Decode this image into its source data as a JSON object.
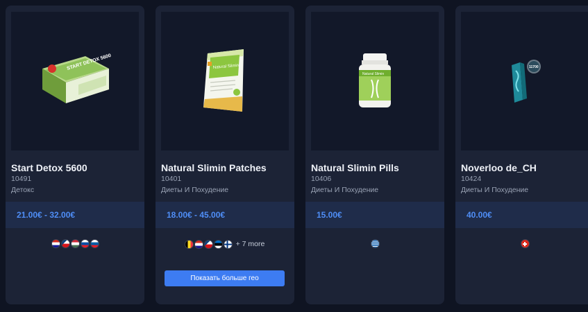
{
  "products": [
    {
      "title": "Start Detox 5600",
      "code": "10491",
      "category": "Детокс",
      "price": "21.00€ - 32.00€",
      "flags": [
        "hr",
        "cz",
        "hu",
        "sk",
        "si"
      ],
      "image_icon": "detox-box-icon",
      "box_text": "START DETOX 5600"
    },
    {
      "title": "Natural Slimin Patches",
      "code": "10401",
      "category": "Диеты И Похудение",
      "price": "18.00€ - 45.00€",
      "flags": [
        "be",
        "hr",
        "cz",
        "ee",
        "fi"
      ],
      "more": "+ 7 more",
      "button": "Показать больше гео",
      "image_icon": "patches-pack-icon",
      "box_text": "Natural Slimin"
    },
    {
      "title": "Natural Slimin Pills",
      "code": "10406",
      "category": "Диеты И Похудение",
      "price": "15.00€",
      "flags": [
        "gr"
      ],
      "image_icon": "pill-bottle-icon",
      "box_text": "Natural Slimin"
    },
    {
      "title": "Noverloo de_CH",
      "code": "10424",
      "category": "Диеты И Похудение",
      "price": "40.00€",
      "flags": [
        "ch"
      ],
      "image_icon": "tube-package-icon",
      "box_text": "11700"
    }
  ]
}
